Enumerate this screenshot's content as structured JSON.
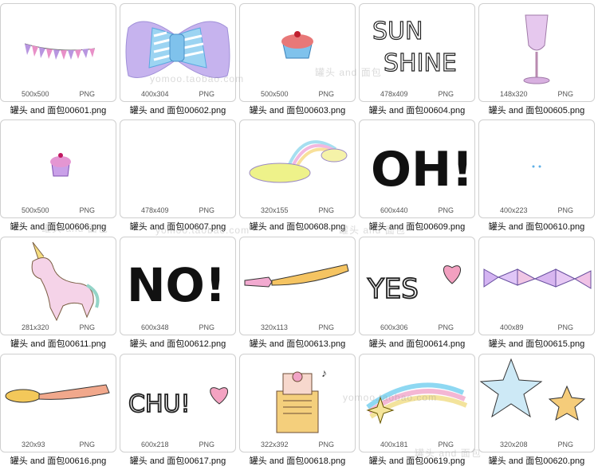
{
  "items": [
    {
      "dims": "500x500",
      "format": "PNG",
      "filename": "罐头 and 面包00601.png",
      "icon": "bunting-flags"
    },
    {
      "dims": "400x304",
      "format": "PNG",
      "filename": "罐头 and 面包00602.png",
      "icon": "bow-tie"
    },
    {
      "dims": "500x500",
      "format": "PNG",
      "filename": "罐头 and 面包00603.png",
      "icon": "cupcake-red"
    },
    {
      "dims": "478x409",
      "format": "PNG",
      "filename": "罐头 and 面包00604.png",
      "icon": "sunshine-text",
      "text": "SUN SHINE"
    },
    {
      "dims": "148x320",
      "format": "PNG",
      "filename": "罐头 and 面包00605.png",
      "icon": "wine-glass"
    },
    {
      "dims": "500x500",
      "format": "PNG",
      "filename": "罐头 and 面包00606.png",
      "icon": "cupcake-purple"
    },
    {
      "dims": "478x409",
      "format": "PNG",
      "filename": "罐头 and 面包00607.png",
      "icon": "blank"
    },
    {
      "dims": "320x155",
      "format": "PNG",
      "filename": "罐头 and 面包00608.png",
      "icon": "rainbow-cloud"
    },
    {
      "dims": "600x440",
      "format": "PNG",
      "filename": "罐头 and 面包00609.png",
      "icon": "oh-text",
      "text": "OH!"
    },
    {
      "dims": "400x223",
      "format": "PNG",
      "filename": "罐头 and 面包00610.png",
      "icon": "dots"
    },
    {
      "dims": "281x320",
      "format": "PNG",
      "filename": "罐头 and 面包00611.png",
      "icon": "unicorn"
    },
    {
      "dims": "600x348",
      "format": "PNG",
      "filename": "罐头 and 面包00612.png",
      "icon": "no-text",
      "text": "NO!"
    },
    {
      "dims": "320x113",
      "format": "PNG",
      "filename": "罐头 and 面包00613.png",
      "icon": "fork"
    },
    {
      "dims": "600x306",
      "format": "PNG",
      "filename": "罐头 and 面包00614.png",
      "icon": "yes-heart",
      "text": "YES"
    },
    {
      "dims": "400x89",
      "format": "PNG",
      "filename": "罐头 and 面包00615.png",
      "icon": "bow-ribbon"
    },
    {
      "dims": "320x93",
      "format": "PNG",
      "filename": "罐头 and 面包00616.png",
      "icon": "spoon"
    },
    {
      "dims": "600x218",
      "format": "PNG",
      "filename": "罐头 and 面包00617.png",
      "icon": "chu-heart",
      "text": "CHU!"
    },
    {
      "dims": "322x392",
      "format": "PNG",
      "filename": "罐头 and 面包00618.png",
      "icon": "music-box"
    },
    {
      "dims": "400x181",
      "format": "PNG",
      "filename": "罐头 and 面包00619.png",
      "icon": "shooting-star"
    },
    {
      "dims": "320x208",
      "format": "PNG",
      "filename": "罐头 and 面包00620.png",
      "icon": "stars"
    }
  ],
  "watermarks": [
    {
      "text": "罐头 and 面包"
    },
    {
      "text": "yomoo.taobao.com"
    },
    {
      "text": "罐头 and 面包"
    },
    {
      "text": "yomoo.taobao.com"
    },
    {
      "text": "罐头 and 面包"
    },
    {
      "text": "yomoo.taobao.com"
    },
    {
      "text": "罐头 and 面包"
    }
  ]
}
